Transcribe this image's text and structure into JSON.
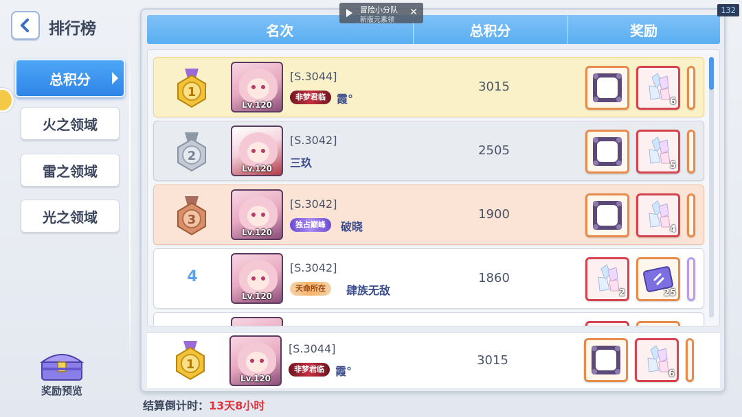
{
  "header": {
    "title": "排行榜",
    "back_icon": "chevron-left-icon"
  },
  "sidebar": {
    "tabs": [
      {
        "label": "总积分",
        "active": true
      },
      {
        "label": "火之领域",
        "active": false
      },
      {
        "label": "雷之领域",
        "active": false
      },
      {
        "label": "光之领域",
        "active": false
      }
    ],
    "reward_preview_label": "奖励预览"
  },
  "table": {
    "columns": {
      "rank": "名次",
      "score": "总积分",
      "reward": "奖励"
    },
    "rows": [
      {
        "rank": 1,
        "rank_display": "1",
        "medal": "gold",
        "server": "[S.3044]",
        "title_badge": "非梦君临",
        "name": "霞°",
        "level": "Lv.120",
        "score": "3015",
        "rewards": [
          {
            "icon": "avatar-frame-icon",
            "count": ""
          },
          {
            "icon": "crystal-icon",
            "count": "6"
          }
        ]
      },
      {
        "rank": 2,
        "rank_display": "2",
        "medal": "silver",
        "server": "[S.3042]",
        "title_badge": "",
        "name": "三玖",
        "level": "Lv.120",
        "score": "2505",
        "rewards": [
          {
            "icon": "avatar-frame-icon",
            "count": ""
          },
          {
            "icon": "crystal-icon",
            "count": "5"
          }
        ]
      },
      {
        "rank": 3,
        "rank_display": "3",
        "medal": "bronze",
        "server": "[S.3042]",
        "title_badge": "独占巅峰",
        "name": "破晓",
        "level": "Lv.120",
        "score": "1900",
        "rewards": [
          {
            "icon": "avatar-frame-icon",
            "count": ""
          },
          {
            "icon": "crystal-icon",
            "count": "4"
          }
        ]
      },
      {
        "rank": 4,
        "rank_display": "4",
        "medal": "",
        "server": "[S.3042]",
        "title_badge": "天命所在",
        "name": "肆族无敌",
        "level": "Lv.120",
        "score": "1860",
        "rewards": [
          {
            "icon": "crystal-icon",
            "count": "2"
          },
          {
            "icon": "ticket-icon",
            "count": "25"
          }
        ]
      }
    ],
    "my_rank": {
      "rank": 1,
      "rank_display": "1",
      "medal": "gold",
      "server": "[S.3044]",
      "title_badge": "非梦君临",
      "name": "霞°",
      "level": "Lv.120",
      "score": "3015",
      "rewards": [
        {
          "icon": "avatar-frame-icon",
          "count": ""
        },
        {
          "icon": "crystal-icon",
          "count": "6"
        }
      ]
    }
  },
  "footer": {
    "countdown_label": "结算倒计时：",
    "countdown_value": "13天8小时"
  },
  "toast": {
    "line1": "冒险小分队",
    "line2": "新版元素领",
    "close_icon": "close-icon"
  },
  "fps": "132",
  "colors": {
    "accent_blue": "#4ea6f7",
    "countdown_red": "#e0343f",
    "gold": "#f2c33a",
    "silver": "#b7bfcc",
    "bronze": "#d9906a"
  }
}
